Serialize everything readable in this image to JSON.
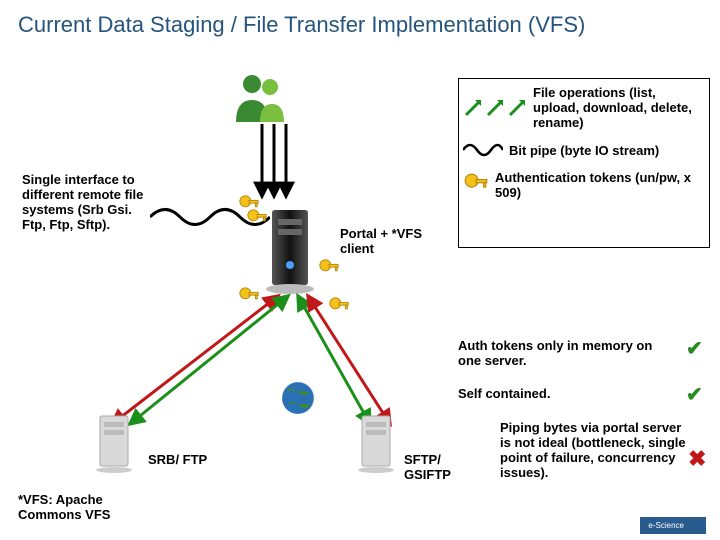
{
  "title": "Current Data Staging / File Transfer Implementation (VFS)",
  "left_note": "Single interface to different remote file systems (Srb Gsi. Ftp, Ftp, Sftp).",
  "center_label": "Portal + *VFS client",
  "legend": {
    "file_ops": "File operations (list, upload, download, delete, rename)",
    "bit_pipe": "Bit pipe (byte IO stream)",
    "auth_tokens": "Authentication tokens (un/pw, x 509)"
  },
  "bullets": {
    "b1": "Auth tokens only in memory on one server.",
    "b2": "Self contained.",
    "b3": "Piping bytes via portal server is not ideal (bottleneck, single point of failure, concurrency issues)."
  },
  "bottom": {
    "srb_ftp": "SRB/ FTP",
    "sftp_gsiftp": "SFTP/ GSIFTP",
    "vfs_note": "*VFS: Apache Commons VFS"
  },
  "logo": "e-Science"
}
